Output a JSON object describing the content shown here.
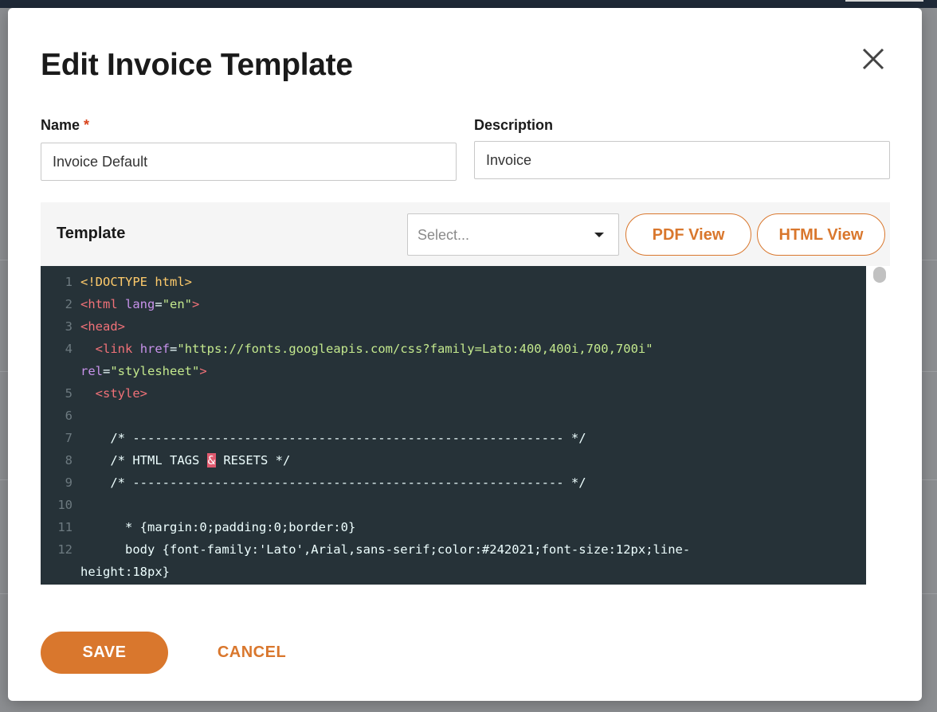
{
  "dialog": {
    "title": "Edit Invoice Template"
  },
  "name_field": {
    "label": "Name",
    "required_mark": "*",
    "value": "Invoice Default"
  },
  "description_field": {
    "label": "Description",
    "value": "Invoice"
  },
  "template": {
    "label": "Template",
    "select_placeholder": "Select...",
    "pdf_view_label": "PDF View",
    "html_view_label": "HTML View"
  },
  "code": {
    "line_numbers": [
      "1",
      "2",
      "3",
      "4",
      "5",
      "6",
      "7",
      "8",
      "9",
      "10",
      "11",
      "12"
    ],
    "l1": "<!DOCTYPE html>",
    "l2_open": "<html",
    "l2_attr": "lang",
    "l2_eq": "=",
    "l2_val": "\"en\"",
    "l2_close": ">",
    "l3": "<head>",
    "l4_open": "<link",
    "l4_attr": "href",
    "l4_eq": "=",
    "l4_val": "\"https://fonts.googleapis.com/css?family=Lato:400,400i,700,700i\"",
    "l4b_attr": "rel",
    "l4b_eq": "=",
    "l4b_val": "\"stylesheet\"",
    "l4b_close": ">",
    "l5": "<style>",
    "l7": "/* ---------------------------------------------------------- */",
    "l8_a": "/* HTML TAGS ",
    "l8_amp": "&",
    "l8_b": " RESETS */",
    "l9": "/* ---------------------------------------------------------- */",
    "l11": "* {margin:0;padding:0;border:0}",
    "l12": "body {font-family:'Lato',Arial,sans-serif;color:#242021;font-size:12px;line-",
    "l12b": "height:18px}"
  },
  "actions": {
    "save_label": "SAVE",
    "cancel_label": "CANCEL"
  },
  "colors": {
    "accent": "#d9772d",
    "editor_bg": "#263238",
    "required": "#d9441c"
  }
}
